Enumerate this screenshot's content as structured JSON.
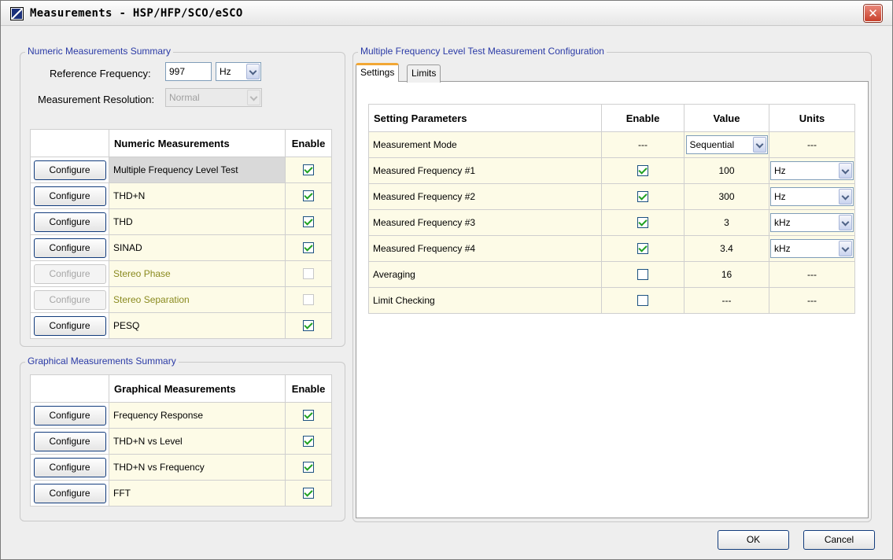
{
  "window": {
    "title": "Measurements - HSP/HFP/SCO/eSCO",
    "close_glyph": "✕"
  },
  "numeric_summary": {
    "group_title": "Numeric Measurements Summary",
    "ref_freq_label": "Reference Frequency:",
    "ref_freq_value": "997",
    "ref_freq_unit": "Hz",
    "resolution_label": "Measurement Resolution:",
    "resolution_value": "Normal",
    "table_header": {
      "name": "Numeric Measurements",
      "enable": "Enable"
    },
    "rows": [
      {
        "button": "Configure",
        "name": "Multiple Frequency Level Test",
        "enabled": true,
        "available": true,
        "selected": true
      },
      {
        "button": "Configure",
        "name": "THD+N",
        "enabled": true,
        "available": true
      },
      {
        "button": "Configure",
        "name": "THD",
        "enabled": true,
        "available": true
      },
      {
        "button": "Configure",
        "name": "SINAD",
        "enabled": true,
        "available": true
      },
      {
        "button": "Configure",
        "name": "Stereo Phase",
        "enabled": false,
        "available": false
      },
      {
        "button": "Configure",
        "name": "Stereo Separation",
        "enabled": false,
        "available": false
      },
      {
        "button": "Configure",
        "name": "PESQ",
        "enabled": true,
        "available": true
      }
    ]
  },
  "graphical_summary": {
    "group_title": "Graphical Measurements Summary",
    "table_header": {
      "name": "Graphical Measurements",
      "enable": "Enable"
    },
    "rows": [
      {
        "button": "Configure",
        "name": "Frequency Response",
        "enabled": true
      },
      {
        "button": "Configure",
        "name": "THD+N vs Level",
        "enabled": true
      },
      {
        "button": "Configure",
        "name": "THD+N vs Frequency",
        "enabled": true
      },
      {
        "button": "Configure",
        "name": "FFT",
        "enabled": true
      }
    ]
  },
  "config": {
    "group_title": "Multiple Frequency Level Test Measurement Configuration",
    "tabs": [
      {
        "label": "Settings",
        "active": true
      },
      {
        "label": "Limits",
        "active": false
      }
    ],
    "table_header": {
      "param": "Setting Parameters",
      "enable": "Enable",
      "value": "Value",
      "units": "Units"
    },
    "rows": [
      {
        "param": "Measurement Mode",
        "enable": "---",
        "value": "Sequential",
        "value_is_combo": true,
        "units": "---"
      },
      {
        "param": "Measured Frequency #1",
        "enabled": true,
        "value": "100",
        "units": "Hz",
        "units_is_combo": true
      },
      {
        "param": "Measured Frequency #2",
        "enabled": true,
        "value": "300",
        "units": "Hz",
        "units_is_combo": true
      },
      {
        "param": "Measured Frequency #3",
        "enabled": true,
        "value": "3",
        "units": "kHz",
        "units_is_combo": true
      },
      {
        "param": "Measured Frequency #4",
        "enabled": true,
        "value": "3.4",
        "units": "kHz",
        "units_is_combo": true
      },
      {
        "param": "Averaging",
        "enabled": false,
        "value": "16",
        "units": "---"
      },
      {
        "param": "Limit Checking",
        "enabled": false,
        "value": "---",
        "units": "---"
      }
    ]
  },
  "buttons": {
    "ok": "OK",
    "cancel": "Cancel"
  }
}
